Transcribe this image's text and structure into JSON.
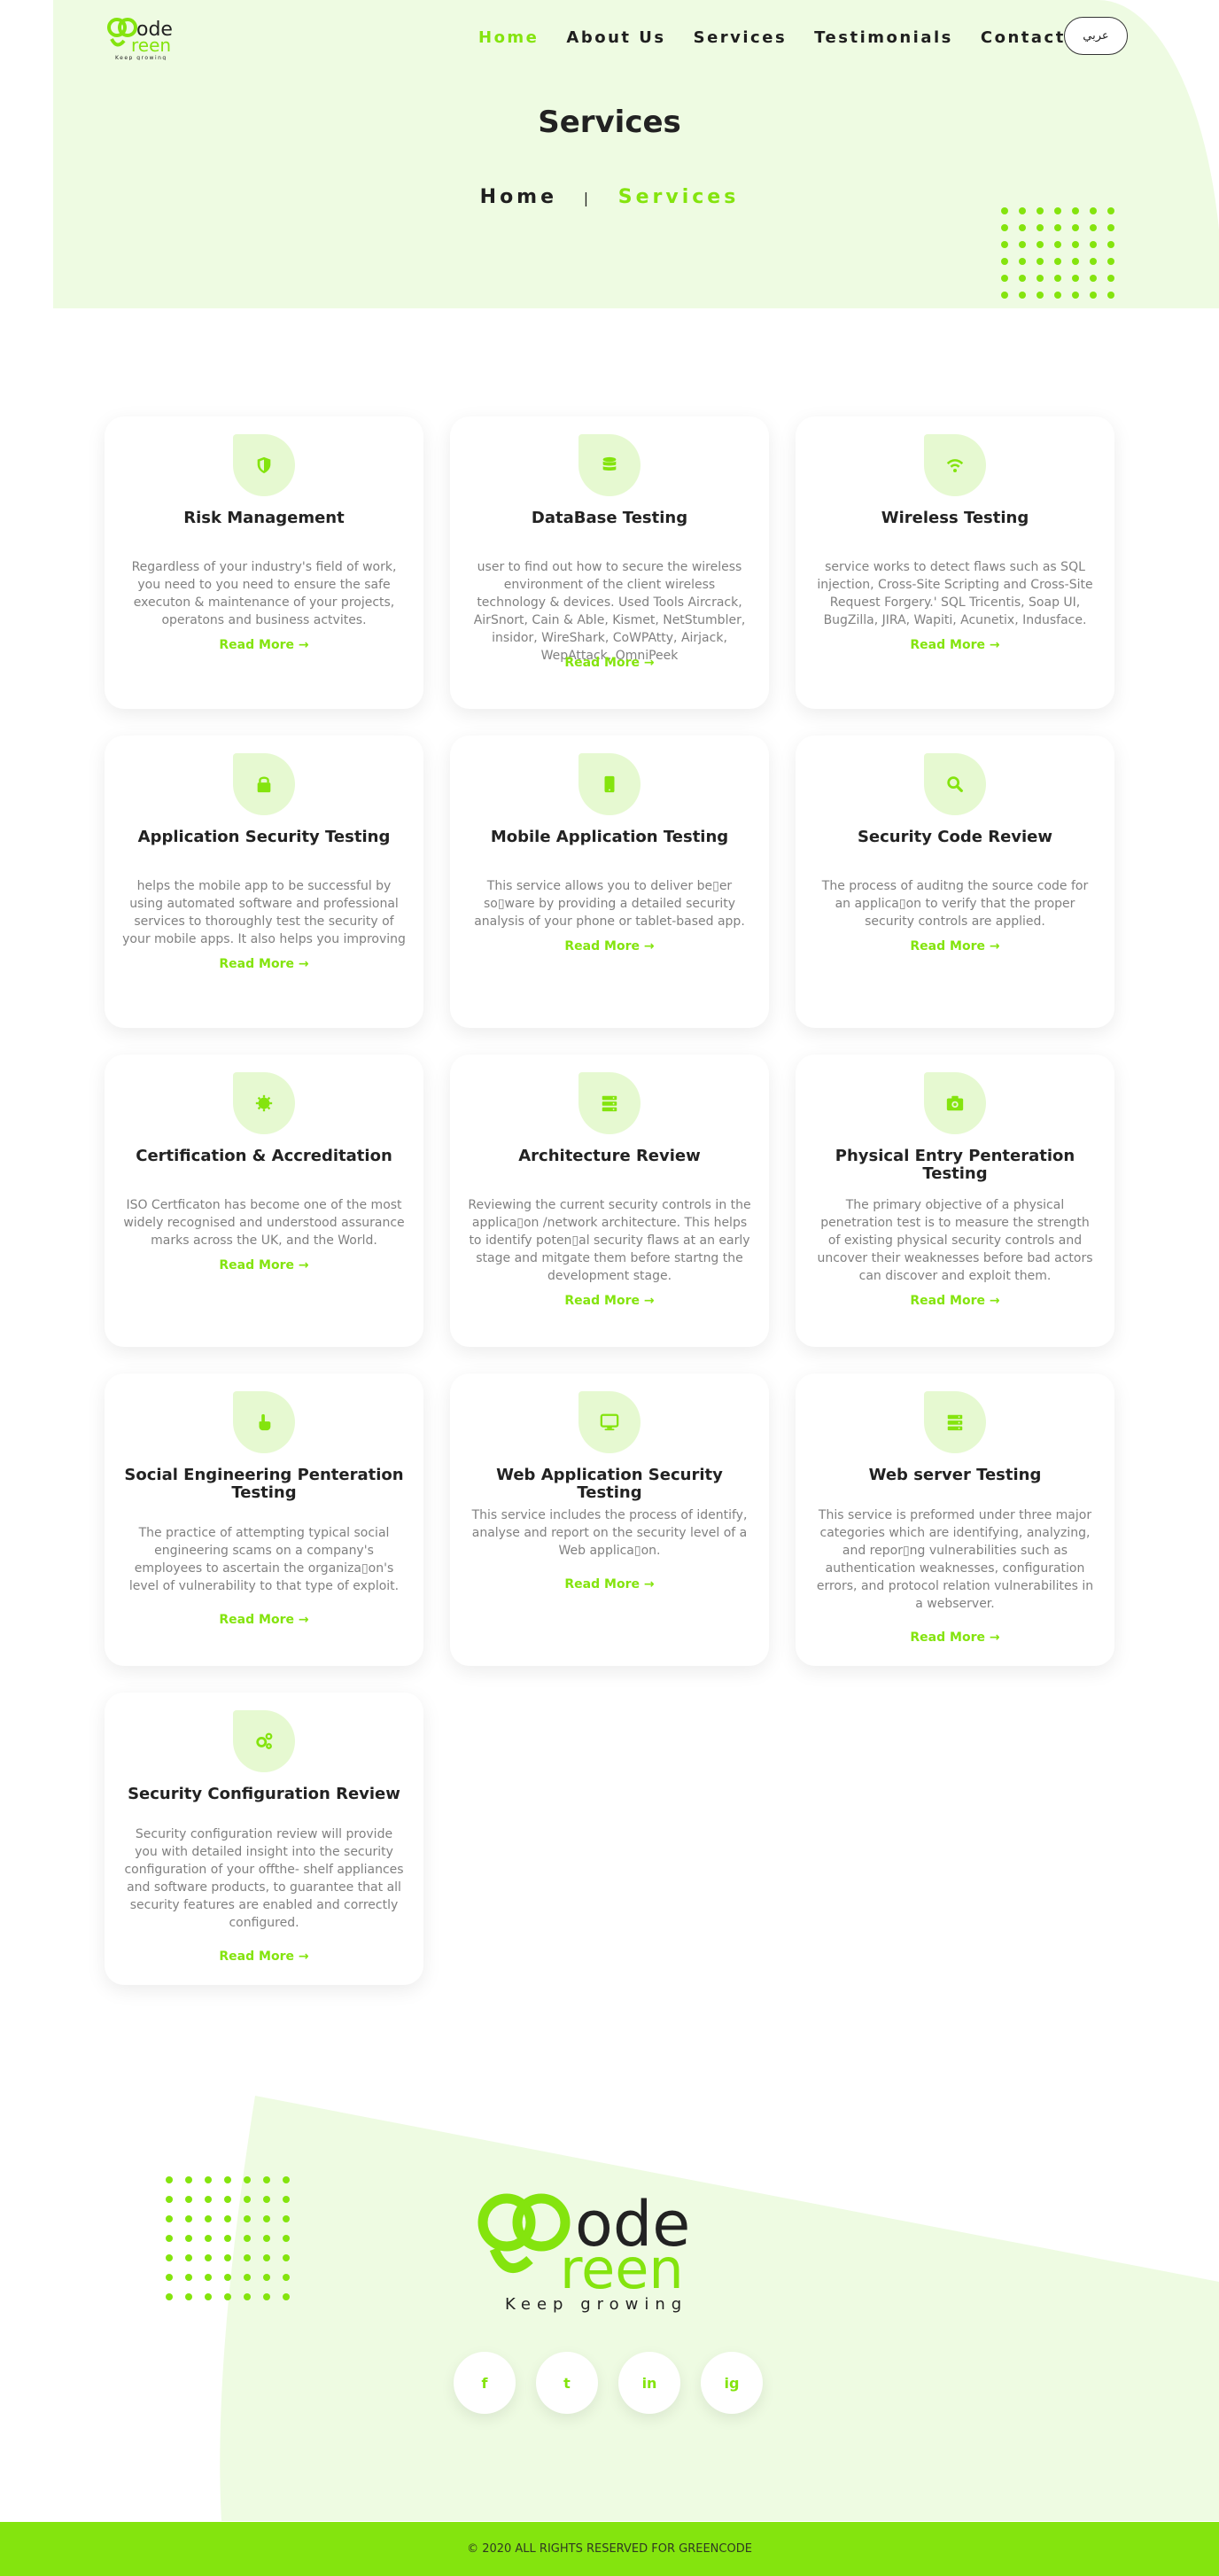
{
  "brand": {
    "logo_text_top": "ode",
    "logo_text_bottom": "reen",
    "tagline": "Keep growing"
  },
  "nav": {
    "items": [
      {
        "label": "Home",
        "active": true
      },
      {
        "label": "About Us",
        "active": false
      },
      {
        "label": "Services",
        "active": false
      },
      {
        "label": "Testimonials",
        "active": false
      },
      {
        "label": "Contact Us",
        "active": false
      }
    ],
    "language_button": "عربي"
  },
  "page": {
    "title": "Services",
    "breadcrumb": {
      "home": "Home",
      "separator": "|",
      "current": "Services"
    }
  },
  "colors": {
    "accent": "#84e40e",
    "hero_bg": "#eefbe2",
    "icon_bg": "#e6f9d1"
  },
  "services": [
    {
      "icon": "shield-icon",
      "title": "Risk Management",
      "description": "Regardless of your industry's field of work, you need to you need to ensure the safe executon & maintenance of your projects, operatons and business actvites.",
      "link": "Read More"
    },
    {
      "icon": "database-icon",
      "title": "DataBase Testing",
      "description": "user to find out how to secure the wireless environment of the client wireless technology & devices. Used Tools Aircrack, AirSnort, Cain & Able, Kismet, NetStumbler, insidor, WireShark, CoWPAtty, Airjack, WepAttack, OmniPeek",
      "link": "Read More"
    },
    {
      "icon": "wifi-icon",
      "title": "Wireless Testing",
      "description": "service works to detect flaws such as SQL injection, Cross-Site Scripting and Cross-Site Request Forgery.' SQL Tricentis, Soap UI, BugZilla, JIRA, Wapiti, Acunetix, Indusface.",
      "link": "Read More"
    },
    {
      "icon": "lock-icon",
      "title": "Application Security Testing",
      "description": "helps the mobile app to be successful by using automated software and professional services to thoroughly test the security of your mobile apps. It also helps you improving",
      "link": "Read More"
    },
    {
      "icon": "mobile-icon",
      "title": "Mobile Application Testing",
      "description": "This service allows you to deliver be▯er so▯ware by providing a detailed security analysis of your phone or tablet-based app.",
      "link": "Read More"
    },
    {
      "icon": "search-icon",
      "title": "Security Code Review",
      "description": "The process of auditng the source code for an applica▯on to verify that the proper security controls are applied.",
      "link": "Read More"
    },
    {
      "icon": "certificate-icon",
      "title": "Certification & Accreditation",
      "description": "ISO Certficaton has become one of the most widely recognised and understood assurance marks across the UK, and the World.",
      "link": "Read More"
    },
    {
      "icon": "server-icon",
      "title": "Architecture Review",
      "description": "Reviewing the current security controls in the applica▯on /network architecture. This helps to identify poten▯al security flaws at an early stage and mitgate them before startng the development stage.",
      "link": "Read More"
    },
    {
      "icon": "camera-icon",
      "title": "Physical Entry Penteration Testing",
      "description": "The primary objective of a physical penetration test is to measure the strength of existing physical security controls and uncover their weaknesses before bad actors can discover and exploit them.",
      "link": "Read More"
    },
    {
      "icon": "hand-pointer-icon",
      "title": "Social Engineering Penteration Testing",
      "description": "The practice of attempting typical social engineering scams on a company's employees to ascertain the organiza▯on's level of vulnerability to that type of exploit.",
      "link": "Read More"
    },
    {
      "icon": "desktop-icon",
      "title": "Web Application Security Testing",
      "description": "This service includes the process of identify, analyse and report on the security level of a Web applica▯on.",
      "link": "Read More"
    },
    {
      "icon": "server-icon",
      "title": "Web server Testing",
      "description": "This service is preformed under three major categories which are identifying, analyzing, and repor▯ng vulnerabilities such as authentication weaknesses, configuration errors, and protocol relation vulnerabilites in a webserver.",
      "link": "Read More"
    },
    {
      "icon": "cogs-icon",
      "title": "Security Configuration Review",
      "description": "Security configuration review will provide you with detailed insight into the security configuration of your offthe- shelf appliances and software products, to guarantee that all security features are enabled and correctly configured.",
      "link": "Read More"
    }
  ],
  "footer": {
    "socials": [
      {
        "name": "facebook-icon",
        "glyph": "f"
      },
      {
        "name": "twitter-icon",
        "glyph": "t"
      },
      {
        "name": "linkedin-icon",
        "glyph": "in"
      },
      {
        "name": "instagram-icon",
        "glyph": "ig"
      }
    ],
    "copyright": "© 2020 ALL RIGHTS RESERVED FOR GREENCODE"
  }
}
